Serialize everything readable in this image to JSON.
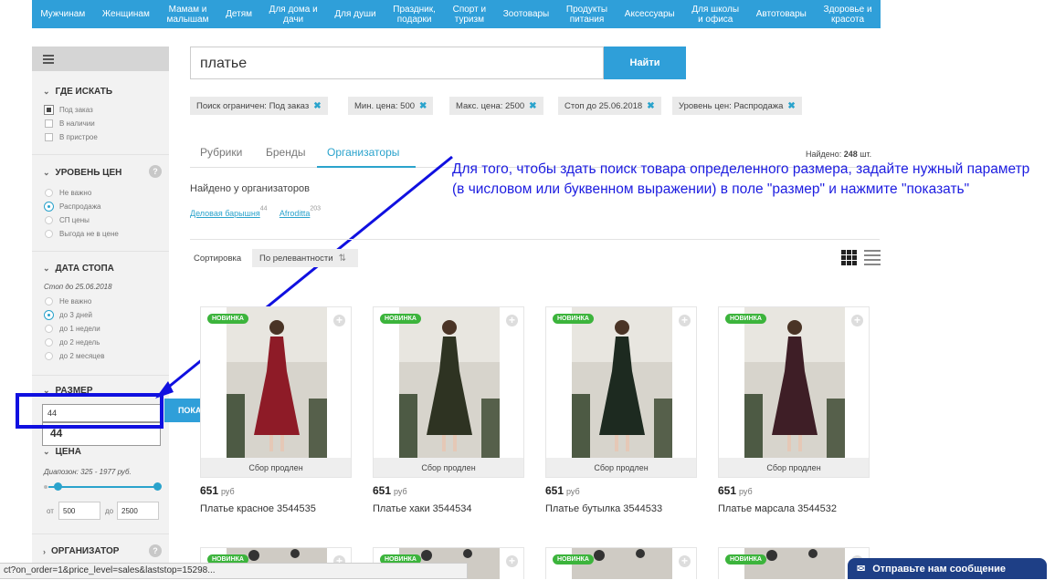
{
  "nav": [
    "Мужчинам",
    "Женщинам",
    "Мамам и\nмалышам",
    "Детям",
    "Для дома и\nдачи",
    "Для души",
    "Праздник,\nподарки",
    "Спорт и\nтуризм",
    "Зоотовары",
    "Продукты\nпитания",
    "Аксессуары",
    "Для школы\nи офиса",
    "Автотовары",
    "Здоровье и\nкрасота"
  ],
  "search": {
    "value": "платье",
    "button": "Найти"
  },
  "chips": [
    "Поиск ограничен: Под заказ",
    "Мин. цена: 500",
    "Макс. цена: 2500",
    "Стоп до 25.06.2018",
    "Уровень цен: Распродажа"
  ],
  "tabs": {
    "rubrics": "Рубрики",
    "brands": "Бренды",
    "organizers": "Организаторы"
  },
  "found": {
    "label": "Найдено:",
    "count": "248",
    "unit": "шт."
  },
  "found_org": "Найдено у организаторов",
  "org_links": [
    {
      "name": "Деловая барышня",
      "count": "44"
    },
    {
      "name": "Afroditta",
      "count": "203"
    }
  ],
  "annotation": "Для того, чтобы здать поиск товара определенного размера, задайте нужный параметр (в числовом или буквенном выражении) в поле \"размер\" и нажмите \"показать\"",
  "sort": {
    "label": "Сортировка",
    "value": "По релевантности"
  },
  "sidebar": {
    "where": {
      "title": "ГДЕ ИСКАТЬ",
      "options": [
        "Под заказ",
        "В наличии",
        "В пристрое"
      ],
      "checked": 0
    },
    "price_level": {
      "title": "УРОВЕНЬ ЦЕН",
      "help": "?",
      "options": [
        "Не важно",
        "Распродажа",
        "СП цены",
        "Выгода не в цене"
      ],
      "selected": 1
    },
    "stop_date": {
      "title": "ДАТА СТОПА",
      "note": "Стоп до 25.06.2018",
      "options": [
        "Не важно",
        "до 3 дней",
        "до 1 недели",
        "до 2 недель",
        "до 2 месяцев"
      ],
      "selected": 1
    },
    "size": {
      "title": "РАЗМЕР",
      "value": "44",
      "suggestion": "44",
      "button": "ПОКАЗАТЬ"
    },
    "price": {
      "title": "ЦЕНА",
      "note": "Диапозон: 325 - 1977 руб.",
      "from_label": "от",
      "from": "500",
      "to_label": "до",
      "to": "2500"
    },
    "organizer": {
      "title": "ОРГАНИЗАТОР",
      "help": "?"
    }
  },
  "products": [
    {
      "badge": "НОВИНКА",
      "status": "Сбор продлен",
      "price": "651",
      "currency": "руб",
      "name": "Платье красное 3544535",
      "color": "#8e1b27"
    },
    {
      "badge": "НОВИНКА",
      "status": "Сбор продлен",
      "price": "651",
      "currency": "руб",
      "name": "Платье хаки 3544534",
      "color": "#2e3322"
    },
    {
      "badge": "НОВИНКА",
      "status": "Сбор продлен",
      "price": "651",
      "currency": "руб",
      "name": "Платье бутылка 3544533",
      "color": "#1d2a20"
    },
    {
      "badge": "НОВИНКА",
      "status": "Сбор продлен",
      "price": "651",
      "currency": "руб",
      "name": "Платье марсала 3544532",
      "color": "#3e1e26"
    }
  ],
  "row2_badge": "НОВИНКА",
  "statusbar": "ct?on_order=1&price_level=sales&laststop=15298...",
  "chat": "Отправьте нам сообщение"
}
